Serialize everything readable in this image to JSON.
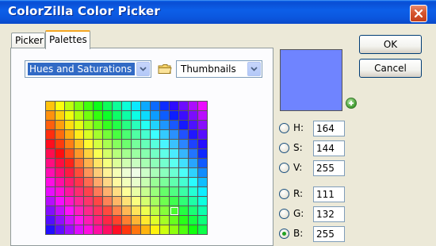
{
  "window": {
    "title": "ColorZilla Color Picker"
  },
  "tabs": [
    {
      "label": "Picker",
      "active": false
    },
    {
      "label": "Palettes",
      "active": true
    }
  ],
  "palette": {
    "type_select": "Hues and Saturations",
    "view_select": "Thumbnails"
  },
  "preview": {
    "color": "#6F84FF"
  },
  "fields": [
    {
      "label": "H:",
      "value": "164",
      "selected": false
    },
    {
      "label": "S:",
      "value": "144",
      "selected": false
    },
    {
      "label": "V:",
      "value": "255",
      "selected": false
    },
    {
      "label": "R:",
      "value": "111",
      "selected": false
    },
    {
      "label": "G:",
      "value": "132",
      "selected": false
    },
    {
      "label": "B:",
      "value": "255",
      "selected": true
    }
  ],
  "buttons": {
    "ok": "OK",
    "cancel": "Cancel"
  },
  "colors": {
    "titlebar": "#0A5FE6",
    "dialog_bg": "#ECE9D8",
    "selection": "#316AC5"
  }
}
